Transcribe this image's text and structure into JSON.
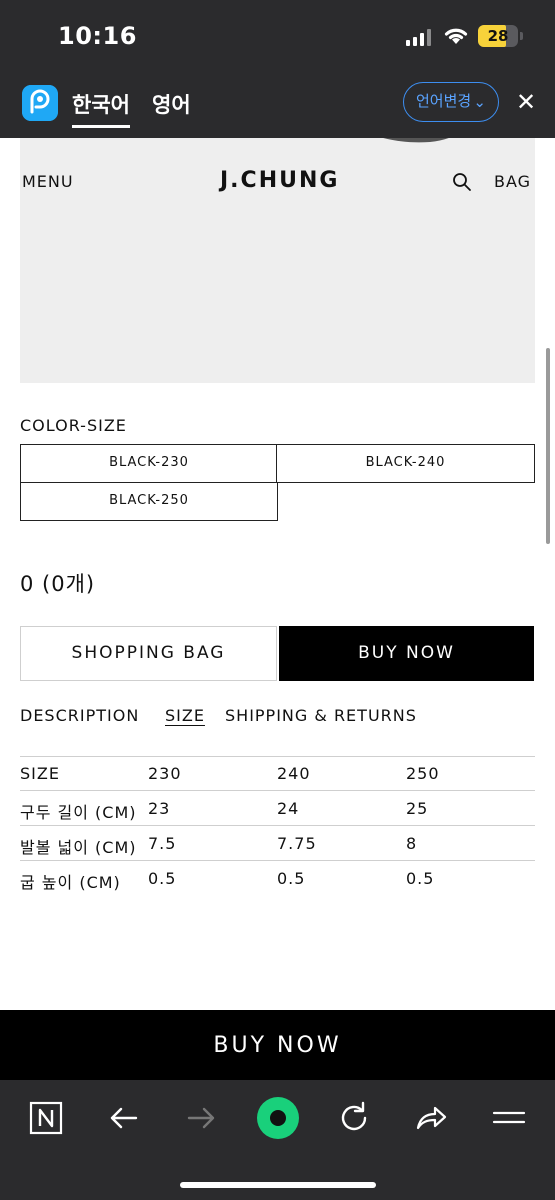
{
  "status_bar": {
    "time": "10:16",
    "battery": "28"
  },
  "translate_bar": {
    "current_lang": "한국어",
    "other_lang": "영어",
    "change_button": "언어변경"
  },
  "site": {
    "menu": "MENU",
    "logo": "J.CHUNG",
    "bag": "BAG"
  },
  "product": {
    "color_size_label": "COLOR-SIZE",
    "options": [
      "BLACK-230",
      "BLACK-240",
      "BLACK-250"
    ],
    "price": "0 (0개)",
    "shopping_bag_button": "SHOPPING BAG",
    "buy_now_button": "BUY NOW"
  },
  "tabs": [
    "DESCRIPTION",
    "SIZE",
    "SHIPPING & RETURNS"
  ],
  "size_table": {
    "headers": [
      "SIZE",
      "230",
      "240",
      "250"
    ],
    "rows": [
      [
        "구두 길이 (CM)",
        "23",
        "24",
        "25"
      ],
      [
        "발볼 넓이 (CM)",
        "7.5",
        "7.75",
        "8"
      ],
      [
        "굽 높이 (CM)",
        "0.5",
        "0.5",
        "0.5"
      ]
    ]
  },
  "bottom_bar": {
    "buy_now": "BUY NOW"
  },
  "browser_toolbar": {
    "icons": [
      "naver-n-icon",
      "back-arrow-icon",
      "forward-arrow-icon",
      "green-dot-icon",
      "reload-icon",
      "share-icon",
      "menu-icon"
    ]
  },
  "colors": {
    "accent_green": "#19d07b",
    "translate_blue": "#3d8ef0",
    "battery_yellow": "#f7d23a"
  }
}
